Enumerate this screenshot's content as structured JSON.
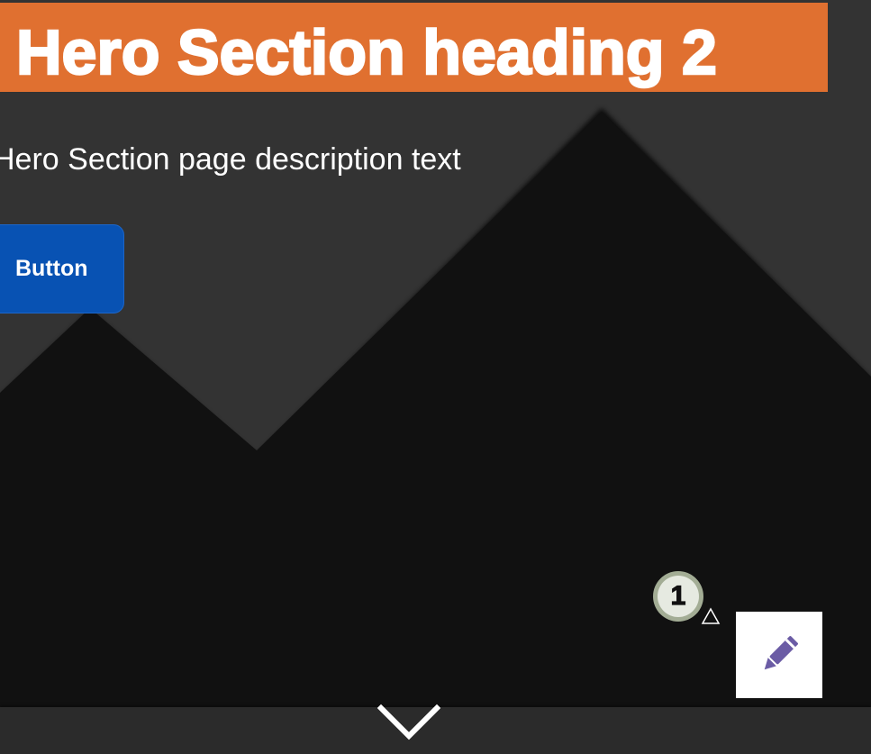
{
  "hero": {
    "heading": "Hero Section heading 2",
    "description": "Hero Section page description text",
    "button_label": "Button"
  },
  "badge": {
    "count": "1"
  },
  "icons": {
    "badge_marker": "triangle-outline-icon",
    "edit": "pencil-icon",
    "scroll_down": "chevron-down-icon"
  },
  "colors": {
    "background": "#333333",
    "mountain": "#111111",
    "heading_band": "#e07030",
    "heading_text": "#ffffff",
    "button": "#0852b3",
    "pencil": "#6b5ca5",
    "badge_ring": "#a3ad95"
  }
}
